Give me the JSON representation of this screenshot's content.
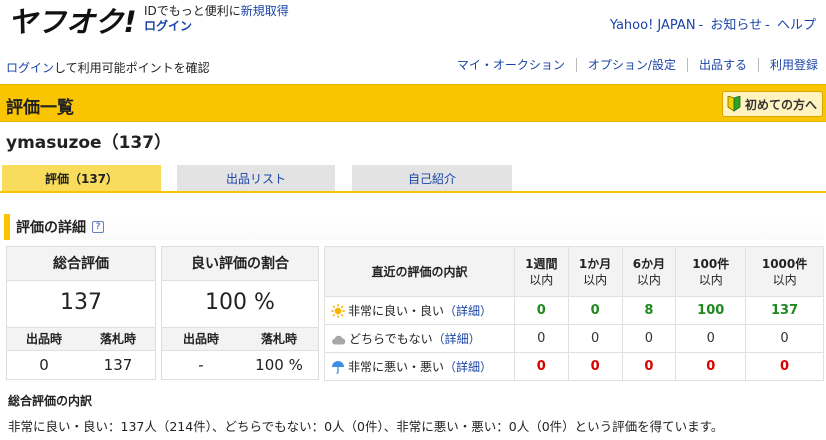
{
  "header": {
    "logo_text": "ヤフオク!",
    "id_promo_text": "IDでもっと便利に",
    "signup_link": "新規取得",
    "login_link": "ログイン",
    "top_links": [
      "Yahoo! JAPAN",
      "お知らせ",
      "ヘルプ"
    ],
    "top_sep": "-"
  },
  "subheader": {
    "login_link": "ログイン",
    "login_suffix": "して利用可能ポイントを確認",
    "nav": [
      "マイ・オークション",
      "オプション/設定",
      "出品する",
      "利用登録"
    ]
  },
  "title_bar": {
    "title": "評価一覧",
    "beginner_label": "初めての方へ"
  },
  "user": {
    "name": "ymasuzoe（137）"
  },
  "tabs": [
    {
      "label": "評価（137）",
      "active": true
    },
    {
      "label": "出品リスト",
      "active": false
    },
    {
      "label": "自己紹介",
      "active": false
    }
  ],
  "section": {
    "title": "評価の詳細",
    "help": "?"
  },
  "total_box": {
    "title": "総合評価",
    "value": "137",
    "sub_left": "出品時",
    "sub_right": "落札時",
    "val_left": "0",
    "val_right": "137"
  },
  "ratio_box": {
    "title": "良い評価の割合",
    "value": "100 %",
    "sub_left": "出品時",
    "sub_right": "落札時",
    "val_left": "-",
    "val_right": "100 %"
  },
  "breakdown": {
    "header_label": "直近の評価の内訳",
    "periods": [
      {
        "top": "1週間",
        "bottom": "以内"
      },
      {
        "top": "1か月",
        "bottom": "以内"
      },
      {
        "top": "6か月",
        "bottom": "以内"
      },
      {
        "top": "100件",
        "bottom": "以内"
      },
      {
        "top": "1000件",
        "bottom": "以内"
      }
    ],
    "rows": [
      {
        "label": "非常に良い・良い",
        "detail": "（詳細）",
        "icon": "sun-icon",
        "color_class": "green",
        "values": [
          "0",
          "0",
          "8",
          "100",
          "137"
        ]
      },
      {
        "label": "どちらでもない",
        "detail": "（詳細）",
        "icon": "cloud-icon",
        "color_class": "gray",
        "values": [
          "0",
          "0",
          "0",
          "0",
          "0"
        ]
      },
      {
        "label": "非常に悪い・悪い",
        "detail": "（詳細）",
        "icon": "umbrella-icon",
        "color_class": "red",
        "values": [
          "0",
          "0",
          "0",
          "0",
          "0"
        ]
      }
    ]
  },
  "summary": {
    "title": "総合評価の内訳",
    "text": "非常に良い・良い：137人（214件）、どちらでもない：0人（0件）、非常に悪い・悪い：0人（0件）という評価を得ています。"
  },
  "colors": {
    "brand_yellow": "#f9c400",
    "link_blue": "#1a44a8",
    "good_green": "#1f8a1f",
    "bad_red": "#d80000"
  }
}
